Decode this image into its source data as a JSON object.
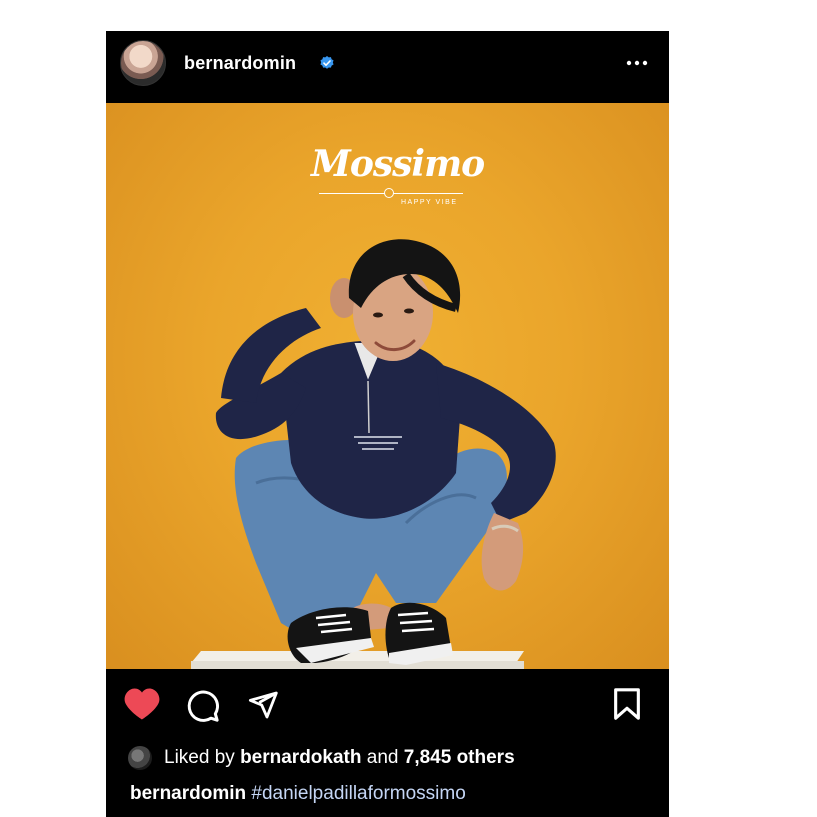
{
  "post": {
    "username": "bernardomin",
    "verified": true,
    "image": {
      "brand_logo_text": "Mossimo",
      "brand_tagline": "HAPPY VIBE"
    },
    "actions": {
      "like_state": "liked",
      "like_color": "#ed4956"
    },
    "likes": {
      "prefix": "Liked by",
      "liker": "bernardokath",
      "conjunction": "and",
      "others": "7,845 others"
    },
    "caption": {
      "username": "bernardomin",
      "hashtag": "#danielpadillaformossimo"
    }
  },
  "colors": {
    "background": "#000000",
    "photo_background": "#eaa52b",
    "verified_badge": "#3897f0",
    "hashtag": "#c5d6f5"
  },
  "icons": [
    "verified-badge-icon",
    "more-options-icon",
    "heart-icon",
    "comment-icon",
    "share-icon",
    "bookmark-icon"
  ]
}
